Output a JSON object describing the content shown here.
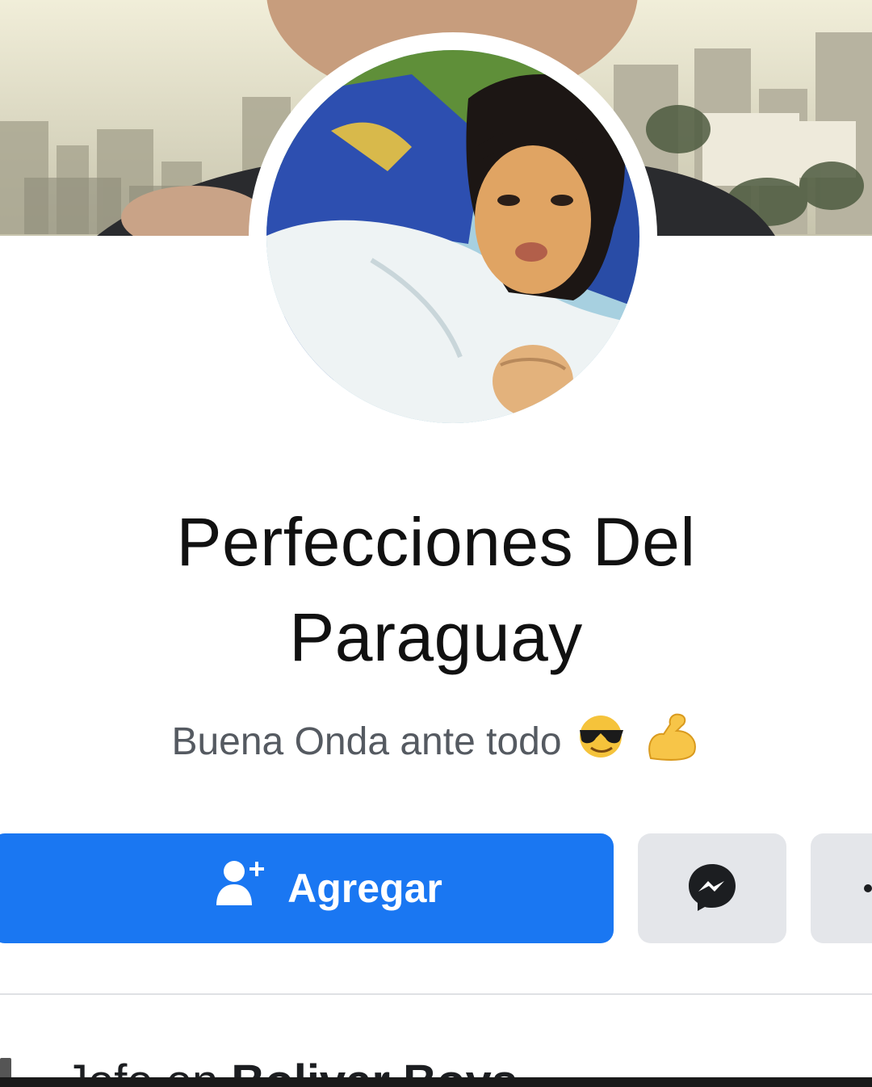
{
  "profile": {
    "name_line1": "Perfecciones Del",
    "name_line2": "Paraguay",
    "bio": "Buena Onda ante todo",
    "bio_emojis": [
      "smiling-face-with-sunglasses",
      "flexed-biceps"
    ]
  },
  "actions": {
    "add_label": "Agregar",
    "message_icon": "messenger-icon",
    "more_icon": "more-icon"
  },
  "info": {
    "prefix": "Jefe en",
    "workplace": "Bolivar Boys"
  },
  "colors": {
    "primary": "#1a77f2",
    "secondary_button": "#e4e6ea",
    "text": "#111111",
    "muted": "#555a61"
  }
}
